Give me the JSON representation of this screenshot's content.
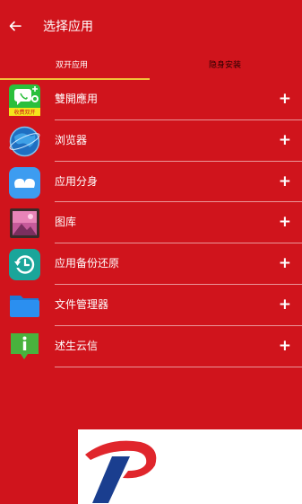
{
  "header": {
    "title": "选择应用"
  },
  "tabs": [
    {
      "label": "双开应用",
      "active": true
    },
    {
      "label": "隐身安装",
      "active": false
    }
  ],
  "apps": [
    {
      "label": "雙開應用",
      "icon": "dual-app-icon",
      "icon_text": "收费双开"
    },
    {
      "label": "浏览器",
      "icon": "browser-globe-icon"
    },
    {
      "label": "应用分身",
      "icon": "app-clone-icon"
    },
    {
      "label": "图库",
      "icon": "gallery-icon"
    },
    {
      "label": "应用备份还原",
      "icon": "backup-restore-icon"
    },
    {
      "label": "文件管理器",
      "icon": "file-manager-icon"
    },
    {
      "label": "述生云信",
      "icon": "info-chat-icon"
    }
  ],
  "add_symbol": "+",
  "colors": {
    "background": "#d0141c",
    "tab_indicator": "#f2c03a",
    "logo_red": "#e0262c",
    "logo_blue": "#1a3e8f"
  }
}
